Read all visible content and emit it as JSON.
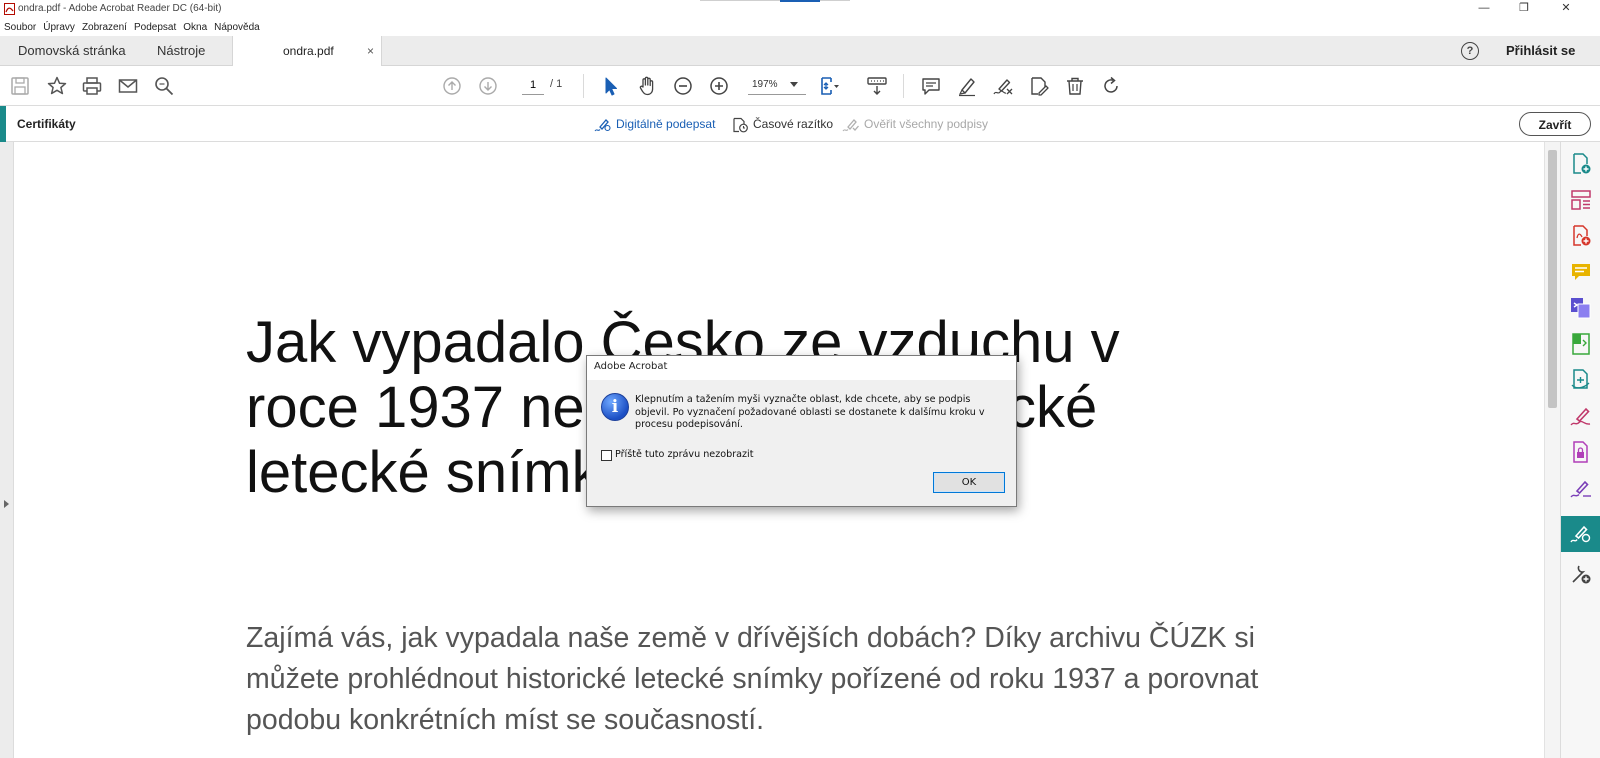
{
  "window": {
    "title": "ondra.pdf - Adobe Acrobat Reader DC (64-bit)",
    "minimize_glyph": "—",
    "restore_glyph": "❐",
    "close_glyph": "✕"
  },
  "menu": [
    "Soubor",
    "Úpravy",
    "Zobrazení",
    "Podepsat",
    "Okna",
    "Nápověda"
  ],
  "tabs": {
    "home": "Domovská stránka",
    "tools": "Nástroje",
    "document": "ondra.pdf",
    "close_glyph": "×",
    "help_glyph": "?",
    "sign_in": "Přihlásit se"
  },
  "toolbar": {
    "page_current": "1",
    "page_total": "/ 1",
    "zoom": "197%"
  },
  "certificates": {
    "title": "Certifikáty",
    "digital_sign": "Digitálně podepsat",
    "timestamp": "Časové razítko",
    "verify_all": "Ověřit všechny podpisy",
    "close": "Zavřít"
  },
  "document": {
    "heading": "Jak vypadalo Česko ze vzduchu v roce 1937 nebo 1953? Historické letecké snímky vás udiví",
    "paragraph": "Zajímá vás, jak vypadala naše země v dřívějších dobách? Díky archivu ČÚZK si můžete prohlédnout historické letecké snímky pořízené od roku 1937 a porovnat podobu konkrétních míst se současností."
  },
  "dialog": {
    "title": "Adobe Acrobat",
    "icon_glyph": "i",
    "message": "Klepnutím a tažením myši vyznačte oblast, kde chcete, aby se podpis objevil. Po vyznačení požadované oblasti se dostanete k dalšímu kroku v procesu podepisování.",
    "checkbox_label": "Příště tuto zprávu nezobrazit",
    "ok": "OK"
  },
  "colors": {
    "accent_teal": "#1a8a8a",
    "link_blue": "#1a5fb4",
    "disabled_gray": "#a8a8a8"
  }
}
